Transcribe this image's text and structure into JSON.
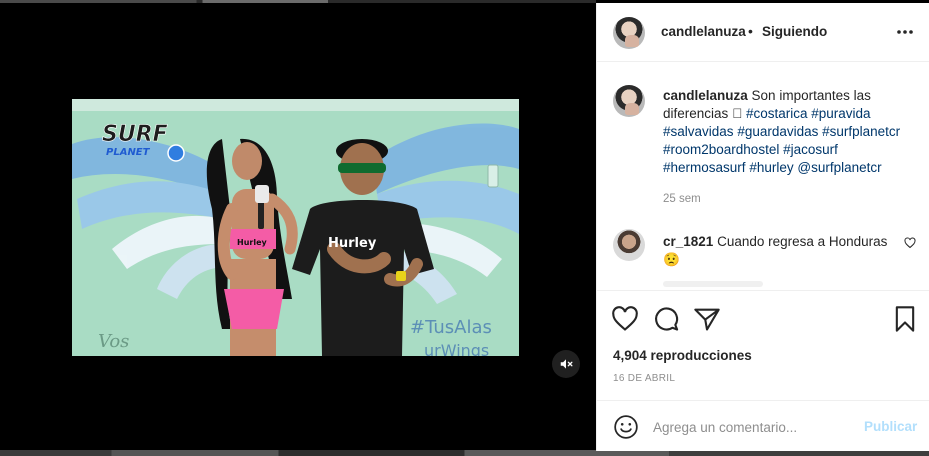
{
  "post": {
    "username": "candlelanuza",
    "follow_separator": "•",
    "follow_status": "Siguiendo",
    "caption": {
      "username": "candlelanuza",
      "text_prefix": "Son importantes las diferencias",
      "emoji_placeholder": "󾓔",
      "hashtags": [
        "#costarica",
        "#puravida",
        "#salvavidas",
        "#guardavidas",
        "#surfplanetcr",
        "#room2boardhostel",
        "#jacosurf",
        "#hermosasurf",
        "#hurley"
      ],
      "mention": "@surfplanetcr"
    },
    "time_ago": "25 sem",
    "comments": [
      {
        "username": "cr_1821",
        "text": "Cuando regresa a Honduras",
        "emoji": "😟"
      }
    ],
    "views": "4,904 reproducciones",
    "date": "16 DE ABRIL"
  },
  "comment_input": {
    "placeholder": "Agrega un comentario...",
    "submit_label": "Publicar"
  },
  "video": {
    "logo_line1": "SURF",
    "logo_line2": "PLANET",
    "shirt_text": "Hurley",
    "top_text": "Hurley",
    "wall_text_1": "#TusAlas",
    "wall_text_2": "urWings",
    "wall_text_3": "Vos"
  },
  "icons": {
    "more": "more-horizontal-icon",
    "heart": "heart-icon",
    "comment": "comment-icon",
    "share": "paper-plane-icon",
    "save": "bookmark-icon",
    "emoji": "smiley-icon",
    "mute": "speaker-muted-icon"
  },
  "colors": {
    "link": "#00376b",
    "muted": "#8e8e8e",
    "post_disabled": "#b2dffc",
    "wall": "#a8dbc2"
  }
}
